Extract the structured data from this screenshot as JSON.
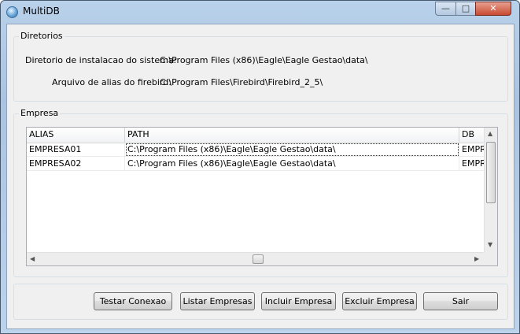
{
  "window": {
    "title": "MultiDB",
    "min_glyph": "—",
    "max_glyph": "□",
    "close_glyph": "✕"
  },
  "diretorios": {
    "title": "Diretorios",
    "install_label": "Diretorio de instalacao do sistema:",
    "install_value": "C:\\Program Files (x86)\\Eagle\\Eagle Gestao\\data\\",
    "alias_label": "Arquivo de alias do firebird:",
    "alias_value": "C:\\Program Files\\Firebird\\Firebird_2_5\\"
  },
  "empresa": {
    "title": "Empresa",
    "columns": [
      "ALIAS",
      "PATH",
      "DB"
    ],
    "rows": [
      [
        "EMPRESA01",
        "C:\\Program Files (x86)\\Eagle\\Eagle Gestao\\data\\",
        "EMPR"
      ],
      [
        "EMPRESA02",
        "C:\\Program Files (x86)\\Eagle\\Eagle Gestao\\data\\",
        "EMPR"
      ]
    ],
    "scroll": {
      "up": "▲",
      "down": "▼",
      "left": "◀",
      "right": "▶"
    }
  },
  "buttons": {
    "testar": "Testar Conexao",
    "listar": "Listar Empresas",
    "incluir": "Incluir Empresa",
    "excluir": "Excluir Empresa",
    "sair": "Sair"
  },
  "colors": {
    "frame": "#b9d1ea",
    "client": "#f0f0f0",
    "close_button": "#c84a30"
  }
}
